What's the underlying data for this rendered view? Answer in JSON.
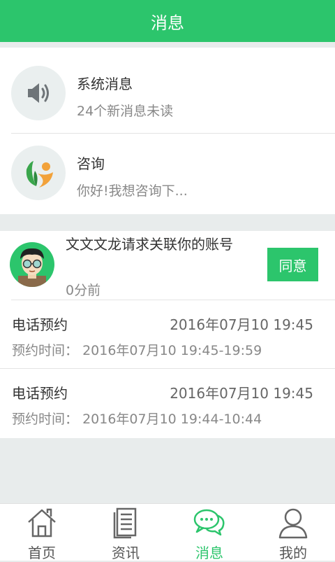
{
  "header": {
    "title": "消息"
  },
  "messages": [
    {
      "title": "系统消息",
      "subtitle": "24个新消息未读",
      "icon": "speaker-icon"
    },
    {
      "title": "咨询",
      "subtitle": "你好!我想咨询下...",
      "icon": "consult-logo-icon"
    }
  ],
  "request": {
    "text": "文文文龙请求关联你的账号",
    "time": "0分前",
    "button_label": "同意"
  },
  "appointments": [
    {
      "type": "电话预约",
      "date": "2016年07月10 19:45",
      "time_label": "预约时间：",
      "time": "2016年07月10 19:45-19:59"
    },
    {
      "type": "电话预约",
      "date": "2016年07月10 19:45",
      "time_label": "预约时间：",
      "time": "2016年07月10 19:44-10:44"
    }
  ],
  "tabs": [
    {
      "label": "首页",
      "icon": "home-icon"
    },
    {
      "label": "资讯",
      "icon": "news-icon"
    },
    {
      "label": "消息",
      "icon": "chat-icon",
      "active": true
    },
    {
      "label": "我的",
      "icon": "profile-icon"
    }
  ],
  "colors": {
    "accent": "#2cc56c",
    "background": "#e8ecec"
  }
}
